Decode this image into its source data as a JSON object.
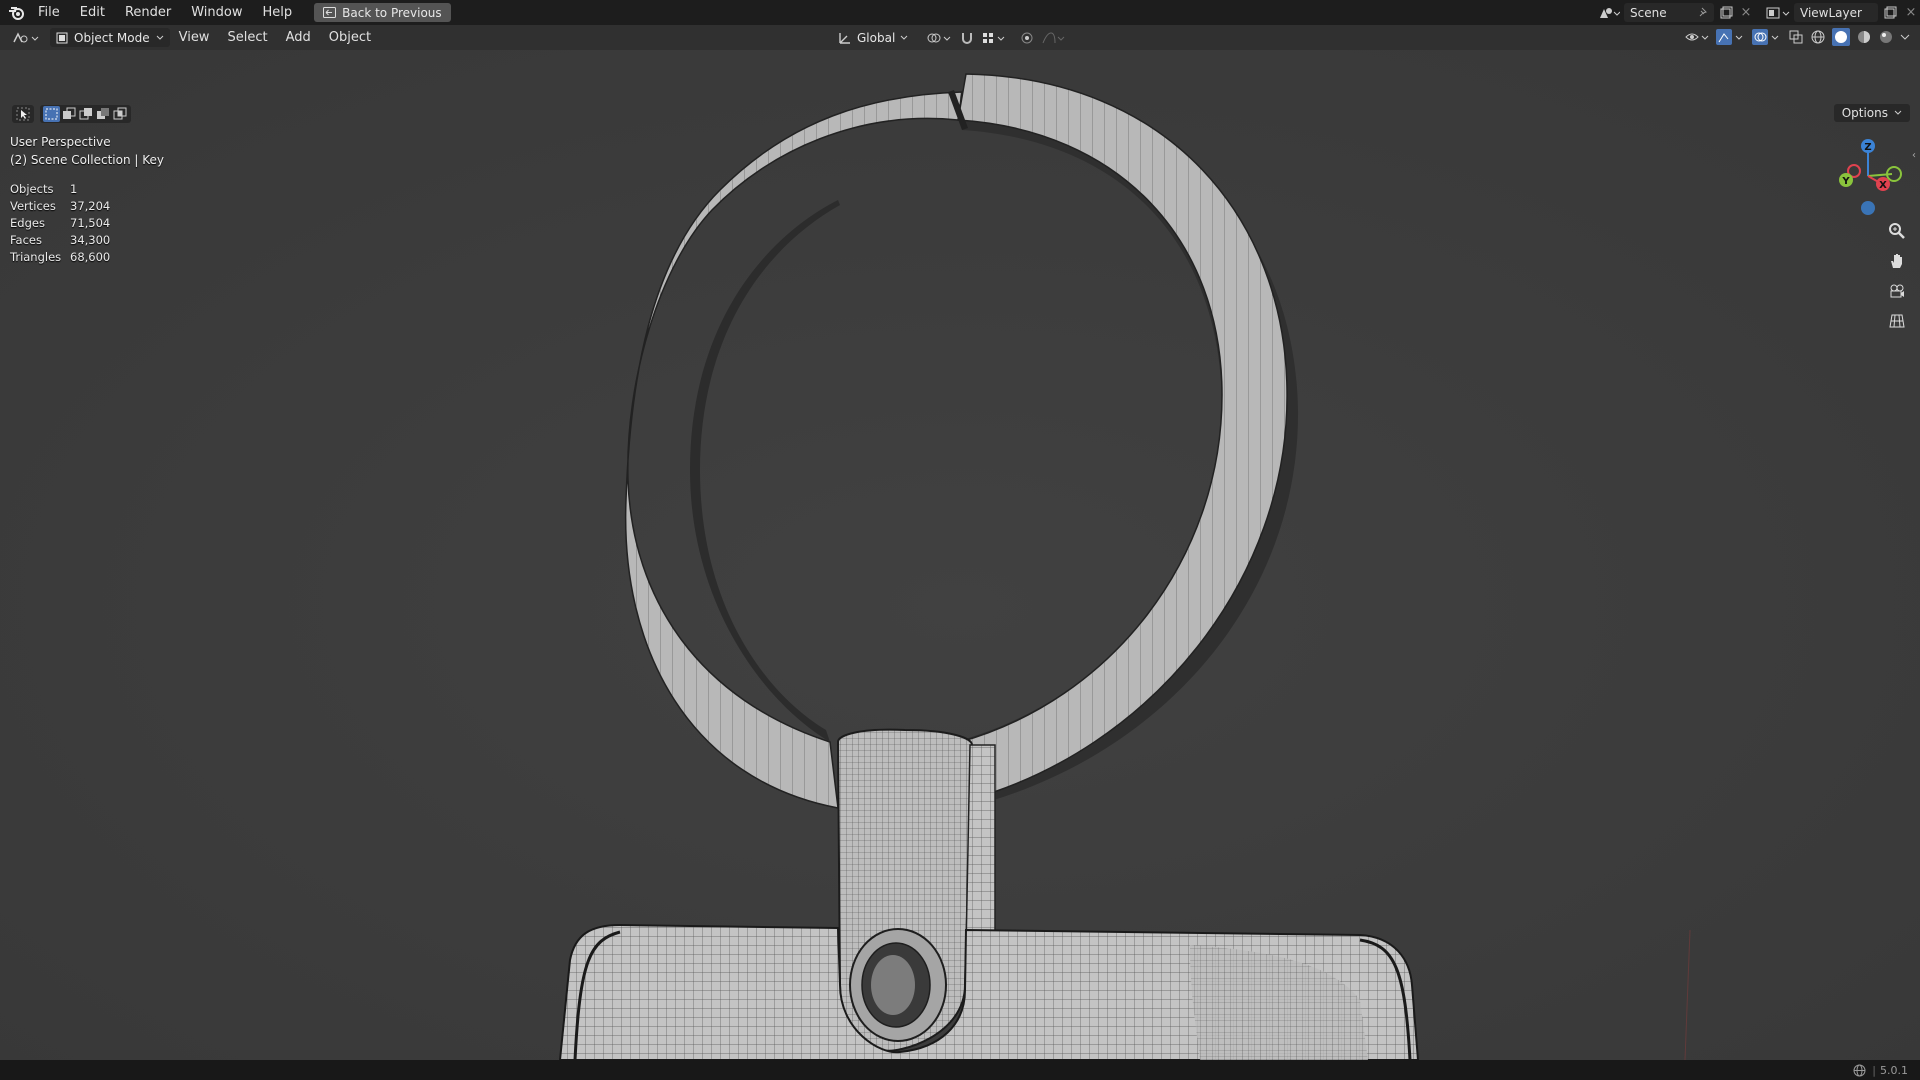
{
  "topbar": {
    "menus": [
      "File",
      "Edit",
      "Render",
      "Window",
      "Help"
    ],
    "back_button": "Back to Previous",
    "scene": "Scene",
    "view_layer": "ViewLayer"
  },
  "header": {
    "mode": "Object Mode",
    "menus": [
      "View",
      "Select",
      "Add",
      "Object"
    ],
    "orientation": "Global",
    "options": "Options"
  },
  "viewport": {
    "perspective": "User Perspective",
    "collection": "(2) Scene Collection | Key",
    "stats": [
      {
        "label": "Objects",
        "value": "1"
      },
      {
        "label": "Vertices",
        "value": "37,204"
      },
      {
        "label": "Edges",
        "value": "71,504"
      },
      {
        "label": "Faces",
        "value": "34,300"
      },
      {
        "label": "Triangles",
        "value": "68,600"
      }
    ],
    "axes": {
      "x": "X",
      "y": "Y",
      "z": "Z"
    }
  },
  "status": {
    "version": "5.0.1"
  },
  "colors": {
    "accent": "#4772b3",
    "axis_x": "#e0424f",
    "axis_y": "#8ac43c",
    "axis_z": "#3b83d6"
  }
}
